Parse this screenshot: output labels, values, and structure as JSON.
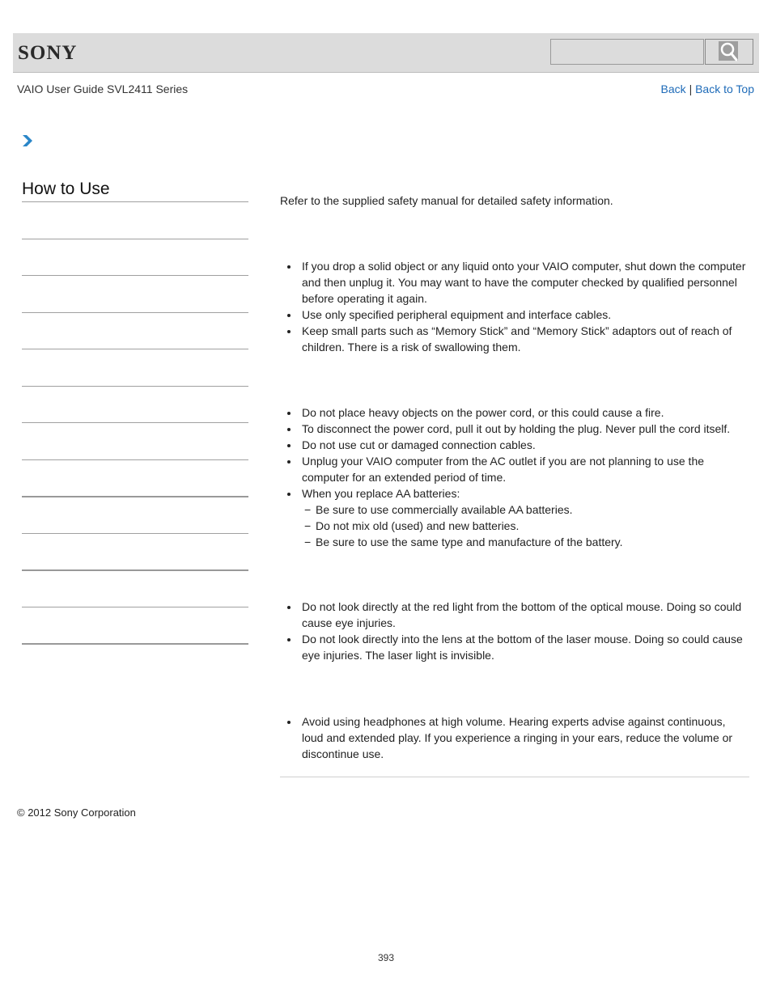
{
  "header": {
    "logo_text": "SONY",
    "search_placeholder": "",
    "search_icon": "magnifier-icon"
  },
  "subheader": {
    "guide_title": "VAIO User Guide SVL2411 Series",
    "back_label": "Back",
    "separator": "|",
    "back_to_top_label": "Back to Top"
  },
  "breadcrumb": {
    "icon": "chevron-right-icon"
  },
  "sidebar": {
    "title": "How to Use",
    "items": [
      "",
      "",
      "",
      "",
      "",
      "",
      "",
      "",
      "",
      "",
      "",
      ""
    ]
  },
  "content": {
    "intro": "Refer to the supplied safety manual for detailed safety information.",
    "sections": [
      {
        "bullets": [
          "If you drop a solid object or any liquid onto your VAIO computer, shut down the computer and then unplug it. You may want to have the computer checked by qualified personnel before operating it again.",
          "Use only specified peripheral equipment and interface cables.",
          "Keep small parts such as “Memory Stick” and “Memory Stick” adaptors out of reach of children. There is a risk of swallowing them."
        ]
      },
      {
        "bullets": [
          "Do not place heavy objects on the power cord, or this could cause a fire.",
          "To disconnect the power cord, pull it out by holding the plug. Never pull the cord itself.",
          "Do not use cut or damaged connection cables.",
          "Unplug your VAIO computer from the AC outlet if you are not planning to use the computer for an extended period of time.",
          "When you replace AA batteries:"
        ],
        "sub_bullets": [
          "Be sure to use commercially available AA batteries.",
          "Do not mix old (used) and new batteries.",
          "Be sure to use the same type and manufacture of the battery."
        ],
        "sub_marker": "−"
      },
      {
        "bullets": [
          "Do not look directly at the red light from the bottom of the optical mouse. Doing so could cause eye injuries.",
          "Do not look directly into the lens at the bottom of the laser mouse. Doing so could cause eye injuries. The laser light is invisible."
        ]
      },
      {
        "bullets": [
          "Avoid using headphones at high volume. Hearing experts advise against continuous, loud and extended play. If you experience a ringing in your ears, reduce the volume or discontinue use."
        ]
      }
    ]
  },
  "footer": {
    "copyright": "© 2012 Sony Corporation",
    "page_number": "393"
  },
  "colors": {
    "header_bg": "#dcdcdc",
    "link": "#1e6bb8",
    "chevron": "#2a86c8"
  }
}
